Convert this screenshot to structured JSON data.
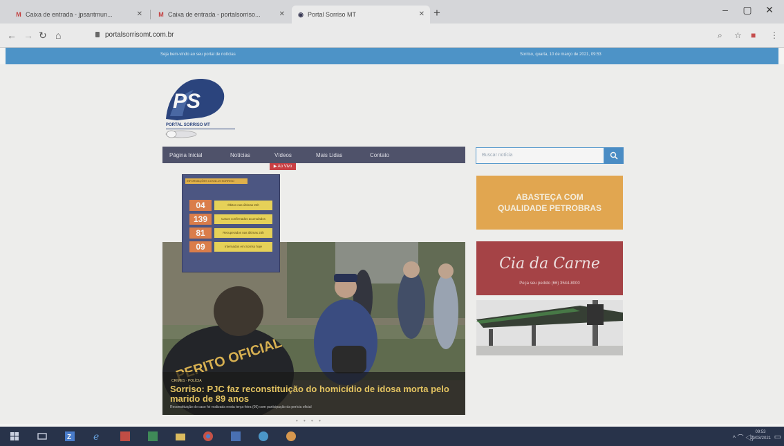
{
  "browser": {
    "tabs": [
      {
        "label": "Caixa de entrada - jpsantmun...",
        "favicon": "gmail-icon"
      },
      {
        "label": "Caixa de entrada - portalsorriso...",
        "favicon": "gmail-icon"
      },
      {
        "label": "Portal Sorriso MT",
        "favicon": "site-icon"
      }
    ],
    "new_tab": "+",
    "url": "portalsorrisomt.com.br",
    "window_controls": {
      "minimize": "–",
      "maximize": "▢",
      "close": "✕"
    }
  },
  "site": {
    "topbar_left": "Seja bem-vindo ao seu portal de notícias",
    "topbar_right": "Sorriso, quarta, 10 de março de 2021, 09:53",
    "logo_text": "PS",
    "logo_subtext": "PORTAL SORRISO MT",
    "nav": [
      "Página Inicial",
      "Notícias",
      "Vídeos",
      "Mais Lidas",
      "Contato"
    ],
    "badge": "▶ Ao Vivo",
    "popup": {
      "title": "INFORMAÇÕES COVID-19 SORRISO",
      "rows": [
        {
          "num": "04",
          "label": "Óbitos nas últimas 24h"
        },
        {
          "num": "139",
          "label": "Casos confirmados acumulados"
        },
        {
          "num": "81",
          "label": "Recuperados nas últimas 24h"
        },
        {
          "num": "09",
          "label": "Internados em Sorriso hoje"
        }
      ]
    },
    "headline": {
      "category": "CRIMES · POLÍCIA",
      "title": "Sorriso: PJC faz reconstituição do homicídio de idosa morta pelo marido de 89 anos",
      "summary": "Reconstituição do caso foi realizada nesta terça-feira (09) com participação da perícia oficial",
      "photo_text": "PERITO OFICIAL"
    },
    "carousel_dots": "• • • •",
    "search": {
      "placeholder": "Buscar notícia"
    },
    "ads": {
      "fuel_line1": "ABASTEÇA COM",
      "fuel_line2": "QUALIDADE PETROBRAS",
      "meat_title": "Cia da Carne",
      "meat_sub": "Peça seu pedido (66) 3544-8000"
    }
  },
  "taskbar": {
    "clock_time": "09:53",
    "clock_date": "10/03/2021",
    "tray": "^ ⌒ ◁)"
  },
  "colors": {
    "topbar": "#3d97d9",
    "nav": "#4a4e6c",
    "popup": "#46528a",
    "fuel_ad": "#f3a83a",
    "meat_ad": "#b73a3e",
    "taskbar": "#1e2c4a"
  }
}
